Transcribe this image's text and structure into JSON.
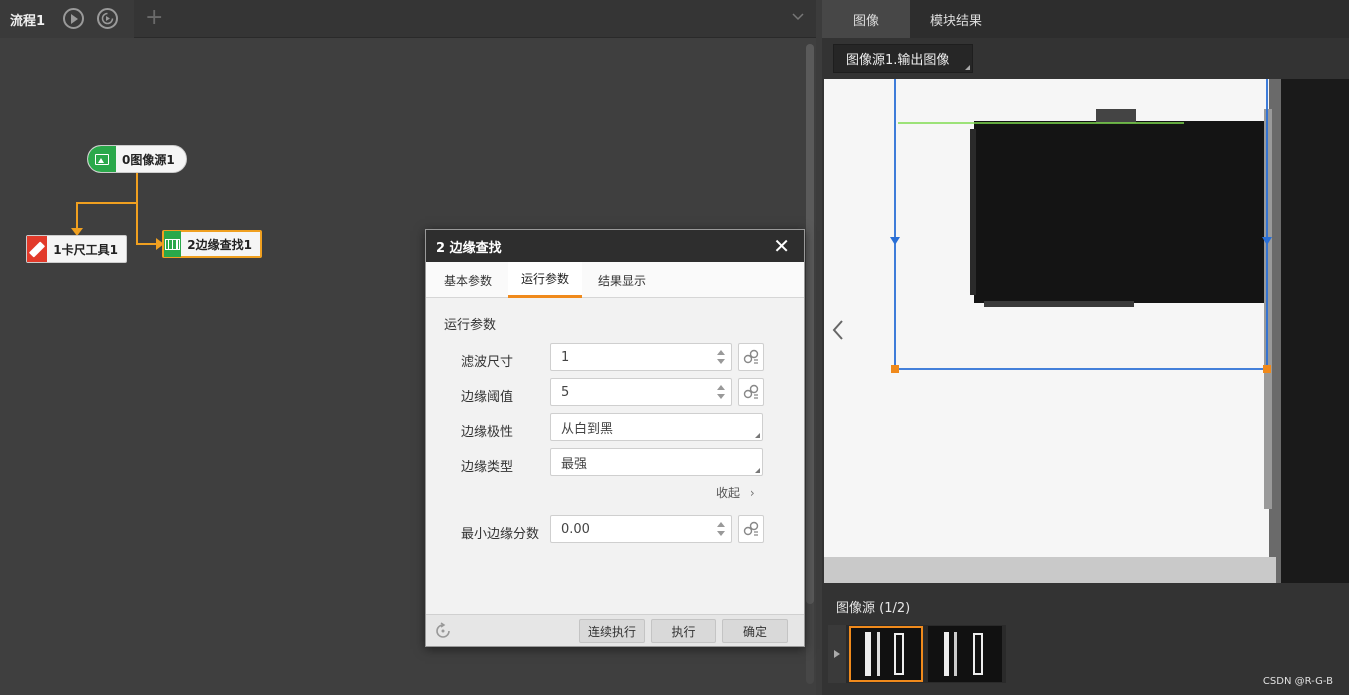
{
  "flow": {
    "tab_label": "流程1",
    "nodes": {
      "image_source": "0图像源1",
      "caliper": "1卡尺工具1",
      "edge_find": "2边缘查找1"
    }
  },
  "dialog": {
    "title": "2 边缘查找",
    "tabs": [
      "基本参数",
      "运行参数",
      "结果显示"
    ],
    "active_tab": "运行参数",
    "section_title": "运行参数",
    "params": [
      {
        "label": "滤波尺寸",
        "value": "1"
      },
      {
        "label": "边缘阈值",
        "value": "5"
      },
      {
        "label": "边缘极性",
        "value": "从白到黑"
      },
      {
        "label": "边缘类型",
        "value": "最强"
      }
    ],
    "collapse_label": "收起",
    "min_score": {
      "label": "最小边缘分数",
      "value": "0.00"
    },
    "buttons": {
      "continuous": "连续执行",
      "run": "执行",
      "ok": "确定"
    }
  },
  "right_panel": {
    "tabs": [
      "图像",
      "模块结果"
    ],
    "active_tab": "图像",
    "image_select": "图像源1.输出图像",
    "thumbnails_title": "图像源 (1/2)"
  },
  "watermark": "CSDN @R-G-B",
  "colors": {
    "accent_orange": "#f08a1c",
    "node_green": "#2aa84a",
    "node_red": "#e23a2a",
    "connector": "#f0a020",
    "roi_blue": "#2a6fd6"
  }
}
